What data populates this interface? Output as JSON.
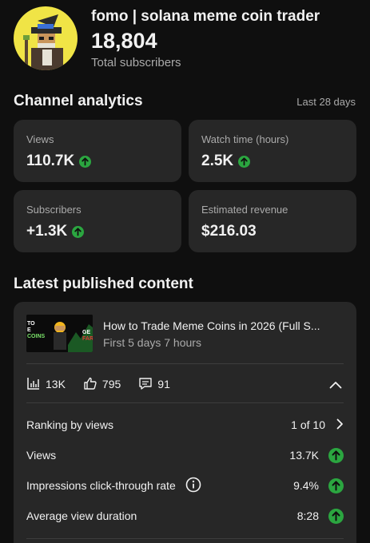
{
  "channel": {
    "name": "fomo | solana meme coin trader",
    "subscribers": "18,804",
    "subscribers_label": "Total subscribers"
  },
  "analytics": {
    "title": "Channel analytics",
    "period": "Last 28 days",
    "cards": [
      {
        "label": "Views",
        "value": "110.7K",
        "trend": "up"
      },
      {
        "label": "Watch time (hours)",
        "value": "2.5K",
        "trend": "up"
      },
      {
        "label": "Subscribers",
        "value": "+1.3K",
        "trend": "up"
      },
      {
        "label": "Estimated revenue",
        "value": "$216.03",
        "trend": "none"
      }
    ]
  },
  "latest": {
    "title": "Latest published content",
    "video": {
      "title": "How to Trade Meme Coins in 2026 (Full S...",
      "subtitle": "First 5 days 7 hours",
      "thumb_left_text": "TO\nE\nCOINS",
      "thumb_right_text": "GE\nFAR"
    },
    "stats": {
      "views": "13K",
      "likes": "795",
      "comments": "91"
    },
    "metrics": [
      {
        "label": "Ranking by views",
        "value": "1 of 10"
      },
      {
        "label": "Views",
        "value": "13.7K"
      },
      {
        "label": "Impressions click-through rate",
        "value": "9.4%"
      },
      {
        "label": "Average view duration",
        "value": "8:28"
      }
    ]
  },
  "colors": {
    "background": "#0f0f0f",
    "card": "#272727",
    "trend_up": "#2ba640",
    "avatar_bg": "#f0e446"
  }
}
